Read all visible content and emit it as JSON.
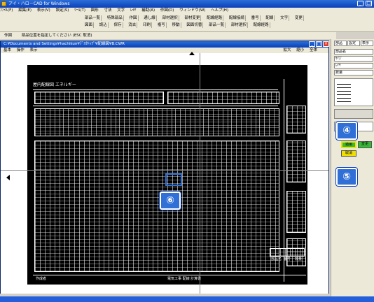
{
  "app": {
    "title": "アイ・ハロ－CAD for Windows",
    "window_buttons": [
      "_",
      "□"
    ]
  },
  "menu": [
    "ﾌｧｲﾙ(F)",
    "編集(E)",
    "表示(V)",
    "設定(S)",
    "ﾂｰﾙ(T)",
    "図形",
    "寸法",
    "文字",
    "ﾚｲﾔ",
    "補助(A)",
    "作図(D)",
    "ウィンドウ(W)",
    "ヘルプ(H)"
  ],
  "toolbar": {
    "row1": [
      "部品一覧",
      "特殊部品",
      "作図",
      "通し線",
      "部材選択",
      "部材変更",
      "配線経路",
      "配線接続",
      "番号",
      "配線",
      "文字",
      "変更"
    ],
    "row2": [
      "図面",
      "読込",
      "保存",
      "消去",
      "印刷",
      "複写",
      "移動",
      "図面切替",
      "部品一覧",
      "部材選択",
      "配線経路"
    ]
  },
  "status": {
    "mode": "作図",
    "prompt": "部品位置を指定してください (ESC 取消)"
  },
  "document": {
    "title": "C:¥Documents and Settings¥hachikun¥ﾃﾞｽｸﾄｯﾌﾟ¥配線図¥B.CWR",
    "menu": [
      "基本",
      "操作",
      "表示"
    ],
    "menu_right": [
      "拡大",
      "縮小",
      "全体"
    ],
    "window_buttons": [
      "_",
      "□",
      "×"
    ]
  },
  "sheet": {
    "header_title": "屋内配線図 エネルギー",
    "footer_label": "作成者",
    "footer_note": "電気工事 配線 計算書",
    "table_headers": [
      "部品名",
      "番号",
      "数量"
    ]
  },
  "right_panel": {
    "tabs": [
      "部品",
      "設定",
      "表示"
    ],
    "rows": [
      "部品名",
      "ｻｲｽﾞ",
      "ﾚｲﾔ",
      "数量"
    ],
    "buttons": [
      "適用",
      "取消",
      "変更"
    ],
    "selected_button": "適用"
  },
  "callouts": {
    "four": "④",
    "five": "⑤",
    "six": "⑥"
  },
  "colors": {
    "titlebar": "#0a3fb8",
    "callout": "#2f6fd6",
    "sheet_bg": "#000000",
    "highlight_yellow": "#f0e000",
    "button_green": "#38b838"
  }
}
